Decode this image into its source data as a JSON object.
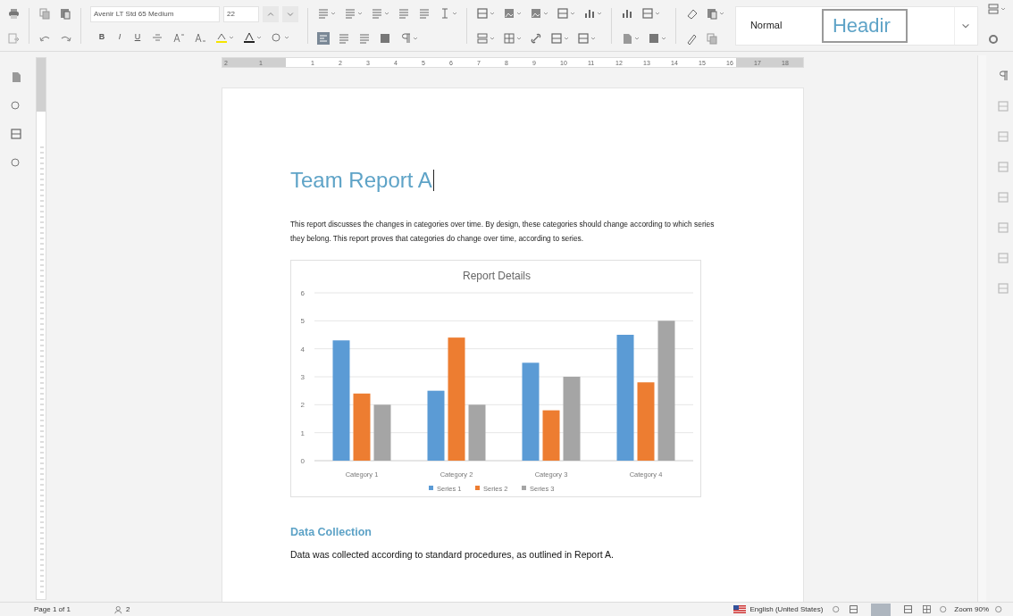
{
  "toolbar": {
    "font_name": "Avenir LT Std 65 Medium",
    "font_size": "22",
    "format_buttons": [
      "B",
      "I",
      "U"
    ],
    "styles": [
      {
        "label": "Normal",
        "kind": "normal",
        "selected": false
      },
      {
        "label": "Headir",
        "kind": "heading",
        "selected": true
      }
    ]
  },
  "ruler": {
    "labels": [
      "2",
      "1",
      "1",
      "2",
      "3",
      "4",
      "5",
      "6",
      "7",
      "8",
      "9",
      "10",
      "11",
      "12",
      "13",
      "14",
      "15",
      "16",
      "17",
      "18"
    ]
  },
  "document": {
    "title": "Team Report A",
    "intro": "This report discusses the changes in categories over time. By design, these categories should change according to which series they belong. This report proves that categories do change over time, according to series.",
    "chart_data": {
      "type": "bar",
      "title": "Report Details",
      "grid": true,
      "legend": true,
      "categories": [
        "Category 1",
        "Category 2",
        "Category 3",
        "Category 4"
      ],
      "ylim": [
        0,
        6
      ],
      "yticks": [
        0,
        1,
        2,
        3,
        4,
        5,
        6
      ],
      "series": [
        {
          "name": "Series 1",
          "color": "#5b9bd5",
          "values": [
            4.3,
            2.5,
            3.5,
            4.5
          ]
        },
        {
          "name": "Series 2",
          "color": "#ed7d31",
          "values": [
            2.4,
            4.4,
            1.8,
            2.8
          ]
        },
        {
          "name": "Series 3",
          "color": "#a5a5a5",
          "values": [
            2,
            2,
            3,
            5
          ]
        }
      ]
    },
    "section_heading": "Data Collection",
    "section_text": "Data was collected according to standard procedures, as outlined in Report A."
  },
  "status_bar": {
    "page": "Page 1 of 1",
    "users": "2",
    "language": "English (United States)",
    "zoom": "Zoom 90%"
  }
}
